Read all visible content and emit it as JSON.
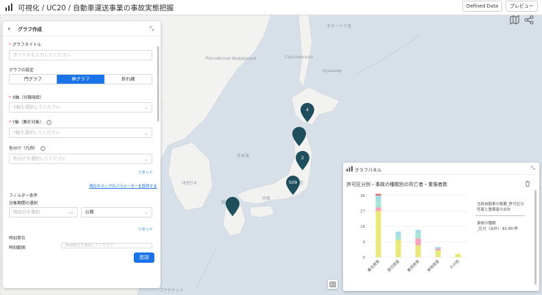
{
  "header": {
    "title": "可視化 / UC20 / 自動車運送事業の事故実態把握",
    "defined_data_label": "Defined Data",
    "preview_label": "プレビュー"
  },
  "map": {
    "labels": {
      "okhotsk": "オホーツク海",
      "sakhalin": "Сахалинская",
      "kuril": "Кунашир",
      "russia": "Российская Федерация",
      "japan_sea": "日本海",
      "korea": "대한민국",
      "osaka": "大阪",
      "tokyo": "東京",
      "fukuoka": "福岡",
      "nagasaki": "コウチケット"
    },
    "pins": [
      {
        "label": "4"
      },
      {
        "label": ""
      },
      {
        "label": "2"
      },
      {
        "label": "509"
      },
      {
        "label": ""
      }
    ],
    "pin_color": "#1f4e5c",
    "water_color": "#d7e0e8",
    "land_color": "#f2f2f0"
  },
  "graph_builder": {
    "title": "グラフ作成",
    "graph_title_label": "グラフタイトル",
    "graph_title_placeholder": "タイトルを入力してください",
    "graph_type_label": "グラフの設定",
    "graph_types": [
      "円グラフ",
      "棒グラフ",
      "折れ線"
    ],
    "active_graph_type": "棒グラフ",
    "x_axis_label": "X軸（分類項目）",
    "x_axis_placeholder": "X軸を選択してください",
    "y_axis_label": "Y軸（集計対象）",
    "y_axis_placeholder": "Y軸を選択してください",
    "color_label": "色分け（凡例）",
    "color_placeholder": "色分けを選択してください",
    "reset_label": "リセット",
    "map_params_link": "現在のマップのパラメーターを取得する",
    "filter_label": "フィルター条件",
    "period_label": "対象期間の選択",
    "start_date_placeholder": "開始日を選択",
    "period_mode": "以降",
    "reset_label_2": "リセット",
    "time_unit_label": "時刻単位",
    "time_filter_label": "時刻範囲",
    "time_filter_placeholder": "時刻単位を選択してください",
    "add_label": "追加"
  },
  "graph_panel": {
    "title": "グラフパネル",
    "chart_title": "許可区分別・事故の種類別の死亡者・重傷者数",
    "legend_title": "当該自動車の概要_許可区分\n死者と重傷者の合計",
    "tooltip_label": "事故の種類",
    "tooltip_sub": "_区分（合計）",
    "tooltip_value": "91.00 件"
  },
  "chart_data": {
    "type": "bar",
    "stacked": true,
    "categories": [
      "乗合旅客",
      "貸切旅客",
      "乗用旅客",
      "貨物旅客",
      "その他"
    ],
    "ytick_labels": [
      "0",
      "9",
      "18",
      "27",
      "36"
    ],
    "ylim": [
      0,
      36
    ],
    "series": [
      {
        "color": "#e8e87e",
        "values": [
          27,
          10,
          7,
          4,
          2
        ]
      },
      {
        "color": "#f4a3b8",
        "values": [
          2,
          0,
          4,
          1,
          0
        ]
      },
      {
        "color": "#a8e6d8",
        "values": [
          4,
          3,
          3,
          0,
          0
        ]
      },
      {
        "color": "#a6dbe8",
        "values": [
          3,
          2,
          2,
          1,
          0
        ]
      },
      {
        "color": "#e36b6b",
        "values": [
          1,
          0,
          0,
          0,
          0
        ]
      }
    ]
  }
}
